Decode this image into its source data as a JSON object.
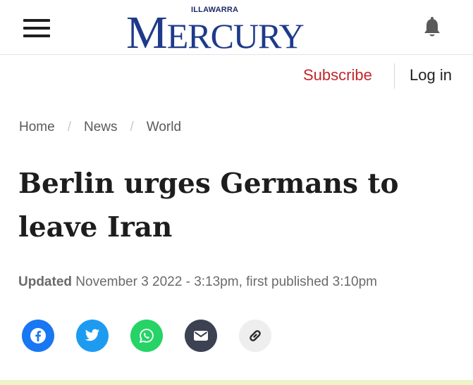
{
  "header": {
    "menu_icon": "hamburger-menu-icon",
    "logo_kicker": "ILLAWARRA",
    "logo_title_first": "M",
    "logo_title_rest": "ERCURY",
    "bell_icon": "bell-icon",
    "brand_color": "#1e3a8a"
  },
  "account": {
    "subscribe_label": "Subscribe",
    "login_label": "Log in",
    "subscribe_color": "#c0282d"
  },
  "breadcrumb": {
    "items": [
      "Home",
      "News",
      "World"
    ],
    "separator": "/"
  },
  "article": {
    "title_line1": "Berlin urges Germans to",
    "title_line2": "leave Iran",
    "updated_label": "Updated",
    "updated_text": "November 3 2022 - 3:13pm, first published 3:10pm"
  },
  "share": {
    "icons": [
      "facebook-icon",
      "twitter-icon",
      "whatsapp-icon",
      "email-icon",
      "link-icon"
    ]
  }
}
